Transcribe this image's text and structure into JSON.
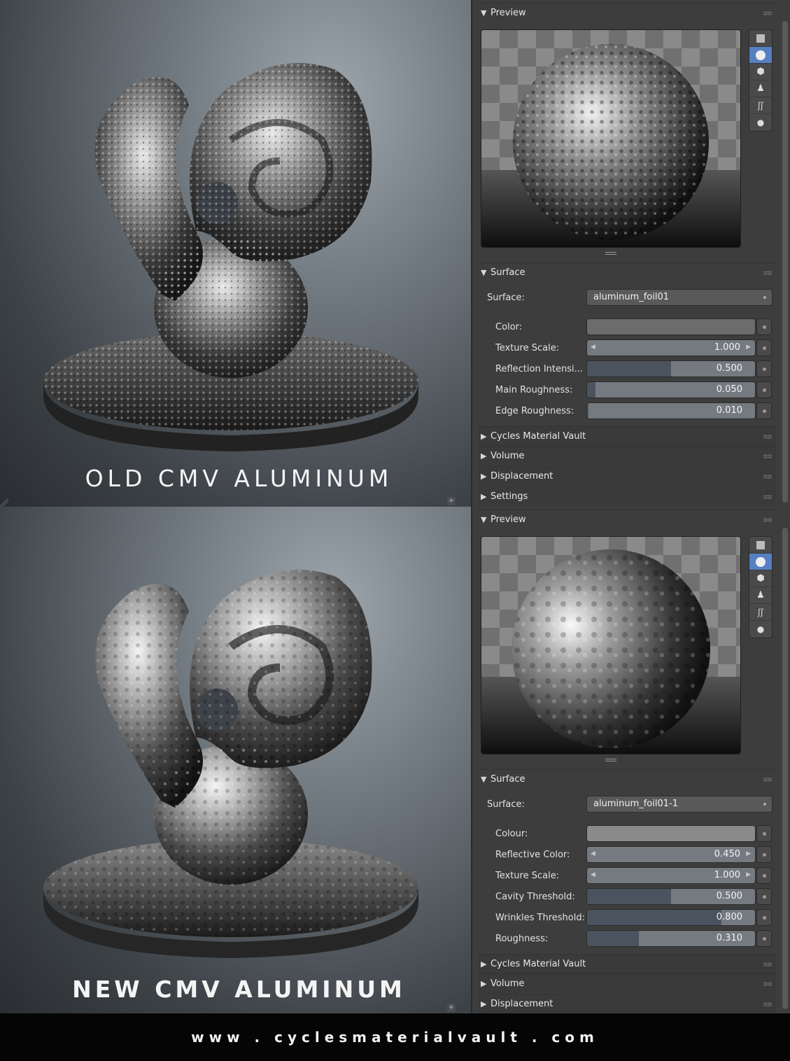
{
  "footer": {
    "url": "www . cyclesmaterialvault . com"
  },
  "top": {
    "caption": "OLD CMV ALUMINUM",
    "panel": {
      "preview": {
        "header": "Preview"
      },
      "surface": {
        "header": "Surface",
        "surface_label": "Surface:",
        "surface_value": "aluminum_foil01",
        "params": [
          {
            "label": "Color:",
            "type": "color"
          },
          {
            "label": "Texture Scale:",
            "type": "number",
            "value": "1.000"
          },
          {
            "label": "Reflection Intensi...",
            "type": "slider",
            "value": "0.500",
            "fraction": 0.5
          },
          {
            "label": "Main Roughness:",
            "type": "slider",
            "value": "0.050",
            "fraction": 0.05
          },
          {
            "label": "Edge Roughness:",
            "type": "slider",
            "value": "0.010",
            "fraction": 0.01
          }
        ]
      },
      "collapsed": [
        "Cycles Material Vault",
        "Volume",
        "Displacement",
        "Settings"
      ]
    }
  },
  "bottom": {
    "caption": "NEW CMV ALUMINUM",
    "panel": {
      "preview": {
        "header": "Preview"
      },
      "surface": {
        "header": "Surface",
        "surface_label": "Surface:",
        "surface_value": "aluminum_foil01-1",
        "params": [
          {
            "label": "Colour:",
            "type": "color"
          },
          {
            "label": "Reflective Color:",
            "type": "number",
            "value": "0.450"
          },
          {
            "label": "Texture Scale:",
            "type": "number",
            "value": "1.000"
          },
          {
            "label": "Cavity Threshold:",
            "type": "slider",
            "value": "0.500",
            "fraction": 0.5
          },
          {
            "label": "Wrinkles Threshold:",
            "type": "slider",
            "value": "0.800",
            "fraction": 0.8
          },
          {
            "label": "Roughness:",
            "type": "slider",
            "value": "0.310",
            "fraction": 0.31
          }
        ]
      },
      "collapsed": [
        "Cycles Material Vault",
        "Volume",
        "Displacement"
      ]
    }
  }
}
